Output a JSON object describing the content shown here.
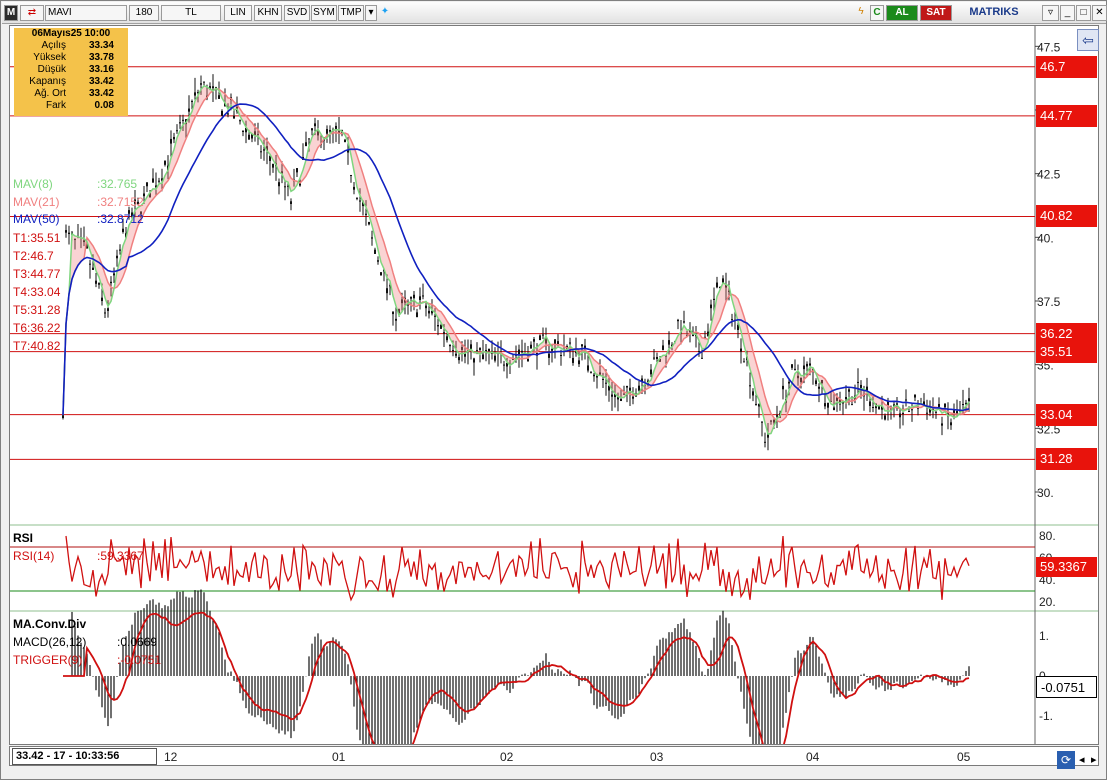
{
  "toolbar": {
    "symbol": "MAVI",
    "period": "180",
    "currency": "TL",
    "lin": "LIN",
    "khn": "KHN",
    "svd": "SVD",
    "sym": "SYM",
    "tmp": "TMP",
    "al": "AL",
    "sat": "SAT",
    "brand": "MATRIKS",
    "c_btn": "C"
  },
  "ohlc": {
    "title": "06Mayıs25 10:00",
    "rows": [
      {
        "k": "Açılış",
        "v": "33.34"
      },
      {
        "k": "Yüksek",
        "v": "33.78"
      },
      {
        "k": "Düşük",
        "v": "33.16"
      },
      {
        "k": "Kapanış",
        "v": "33.42"
      },
      {
        "k": "Ağ. Ort",
        "v": "33.42"
      },
      {
        "k": "Fark",
        "v": "0.08"
      }
    ]
  },
  "legend": {
    "mav8_label": "MAV(8)",
    "mav8_value": ":32.765",
    "mav21_label": "MAV(21)",
    "mav21_value": ":32.7152",
    "mav50_label": "MAV(50)",
    "mav50_value": ":32.8712",
    "targets": [
      "T1:35.51",
      "T2:46.7",
      "T3:44.77",
      "T4:33.04",
      "T5:31.28",
      "T6:36.22",
      "T7:40.82"
    ]
  },
  "price_axis": {
    "ticks": [
      "47.5",
      "45",
      "42.5",
      "40.",
      "37.5",
      "35.",
      "32.5",
      "30."
    ],
    "levels": [
      {
        "label": "46.7",
        "value": 46.7
      },
      {
        "label": "44.77",
        "value": 44.77
      },
      {
        "label": "40.82",
        "value": 40.82
      },
      {
        "label": "36.22",
        "value": 36.22
      },
      {
        "label": "35.51",
        "value": 35.51
      },
      {
        "label": "33.04",
        "value": 33.04
      },
      {
        "label": "31.28",
        "value": 31.28
      }
    ]
  },
  "rsi": {
    "title": "RSI",
    "label": "RSI(14)",
    "value": ":59.3367",
    "tag": "59.3367",
    "ticks": [
      "80.",
      "60.",
      "40.",
      "20."
    ]
  },
  "macd": {
    "title": "MA.Conv.Div",
    "label": "MACD(26,12)",
    "value": ":0.0669",
    "trigger_label": "TRIGGER(9)",
    "trigger_value": ":-0.0751",
    "tag": "-0.0751",
    "ticks": [
      "1.",
      "0.",
      "-1."
    ]
  },
  "x_axis": {
    "ticks": [
      "12",
      "01",
      "02",
      "03",
      "04",
      "05"
    ]
  },
  "status": {
    "text": "33.42 - 17 - 10:33:56"
  },
  "colors": {
    "mav8": "#7fd67f",
    "mav21": "#f08080",
    "mav50": "#1020c0",
    "level_line": "#d01010",
    "tag_bg": "#e8130c"
  },
  "chart_data": {
    "type": "line",
    "title": "MAVI",
    "x": [
      "12",
      "01",
      "02",
      "03",
      "04",
      "05"
    ],
    "series": [
      {
        "name": "MAV(50)",
        "values": [
          39.0,
          42.5,
          37.5,
          34.4,
          35.3,
          33.6
        ]
      },
      {
        "name": "MAV(21)",
        "values": [
          38.8,
          43.0,
          35.3,
          34.1,
          34.2,
          32.7
        ]
      },
      {
        "name": "MAV(8)",
        "values": [
          39.5,
          43.5,
          35.0,
          34.5,
          33.8,
          32.77
        ]
      }
    ],
    "ylim": [
      29.0,
      48.5
    ]
  }
}
